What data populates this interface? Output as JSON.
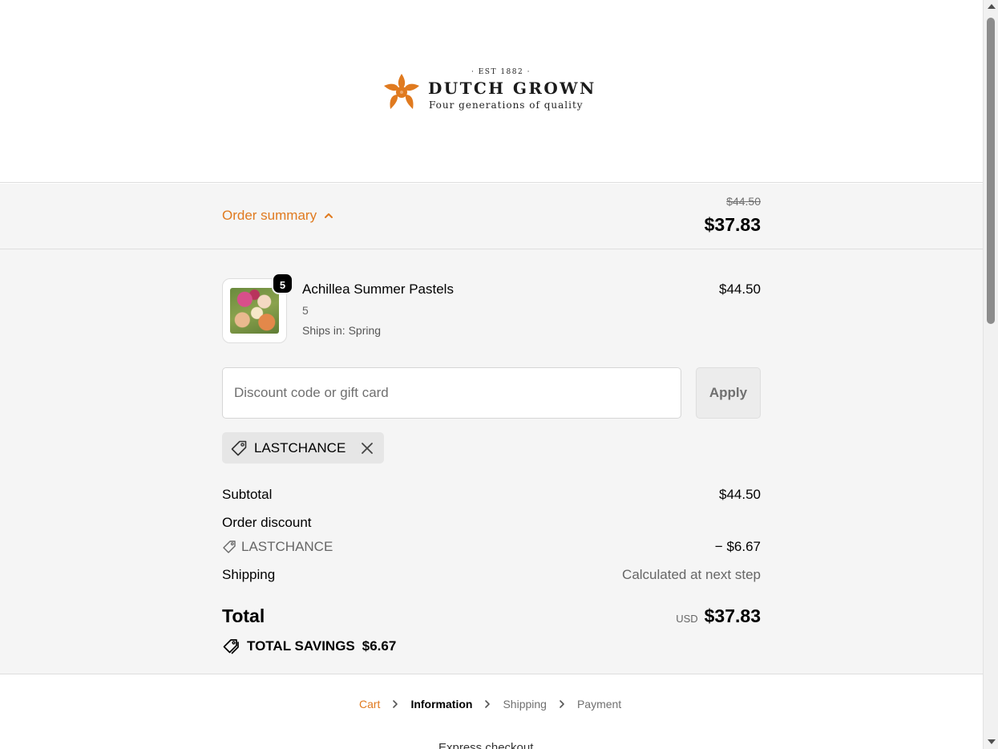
{
  "brand": {
    "est": "· EST 1882 ·",
    "name": "DUTCH GROWN",
    "tagline": "Four generations of quality",
    "logo_icon": "orange-flower-icon",
    "accent_color": "#e07a1f"
  },
  "summary_bar": {
    "toggle_label": "Order summary",
    "original_price": "$44.50",
    "total": "$37.83"
  },
  "line_items": [
    {
      "name": "Achillea Summer Pastels",
      "quantity": "5",
      "variant": "5",
      "ships": "Ships in: Spring",
      "price": "$44.50"
    }
  ],
  "discount": {
    "placeholder": "Discount code or gift card",
    "value": "",
    "apply_label": "Apply",
    "applied_code": "LASTCHANCE"
  },
  "totals": {
    "subtotal_label": "Subtotal",
    "subtotal_value": "$44.50",
    "order_discount_label": "Order discount",
    "discount_code": "LASTCHANCE",
    "discount_value": "− $6.67",
    "shipping_label": "Shipping",
    "shipping_value": "Calculated at next step",
    "total_label": "Total",
    "currency": "USD",
    "total_value": "$37.83",
    "savings_label": "TOTAL SAVINGS",
    "savings_value": "$6.67"
  },
  "breadcrumb": {
    "cart": "Cart",
    "information": "Information",
    "shipping": "Shipping",
    "payment": "Payment"
  },
  "next_section_text": "Express checkout"
}
